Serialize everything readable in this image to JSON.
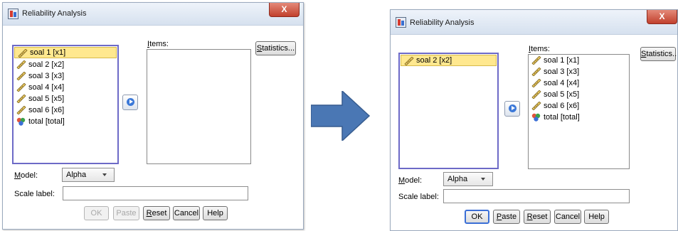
{
  "colors": {
    "arrow": "#4a77b4",
    "selection": "#ffe88f",
    "close_button": "#c1402d"
  },
  "before": {
    "title": "Reliability Analysis",
    "close_label": "X",
    "items_label": "Items:",
    "statistics_label": "Statistics...",
    "model_label": "Model:",
    "model_value": "Alpha",
    "scale_label": "Scale label:",
    "scale_value": "",
    "variables": [
      {
        "label": "soal 1 [x1]",
        "icon": "ruler-icon"
      },
      {
        "label": "soal 2 [x2]",
        "icon": "ruler-icon"
      },
      {
        "label": "soal 3 [x3]",
        "icon": "ruler-icon"
      },
      {
        "label": "soal 4 [x4]",
        "icon": "ruler-icon"
      },
      {
        "label": "soal 5 [x5]",
        "icon": "ruler-icon"
      },
      {
        "label": "soal 6 [x6]",
        "icon": "ruler-icon"
      },
      {
        "label": "total [total]",
        "icon": "nominal-icon"
      }
    ],
    "items": [],
    "buttons": {
      "ok": "OK",
      "paste": "Paste",
      "reset": "Reset",
      "cancel": "Cancel",
      "help": "Help"
    }
  },
  "after": {
    "title": "Reliability Analysis",
    "close_label": "X",
    "items_label": "Items:",
    "statistics_label": "Statistics...",
    "model_label": "Model:",
    "model_value": "Alpha",
    "scale_label": "Scale label:",
    "scale_value": "",
    "variables": [
      {
        "label": "soal 2 [x2]",
        "icon": "ruler-icon"
      }
    ],
    "items": [
      {
        "label": "soal 1 [x1]",
        "icon": "ruler-icon"
      },
      {
        "label": "soal 3 [x3]",
        "icon": "ruler-icon"
      },
      {
        "label": "soal 4 [x4]",
        "icon": "ruler-icon"
      },
      {
        "label": "soal 5 [x5]",
        "icon": "ruler-icon"
      },
      {
        "label": "soal 6 [x6]",
        "icon": "ruler-icon"
      },
      {
        "label": "total [total]",
        "icon": "nominal-icon"
      }
    ],
    "buttons": {
      "ok": "OK",
      "paste": "Paste",
      "reset": "Reset",
      "cancel": "Cancel",
      "help": "Help"
    }
  }
}
